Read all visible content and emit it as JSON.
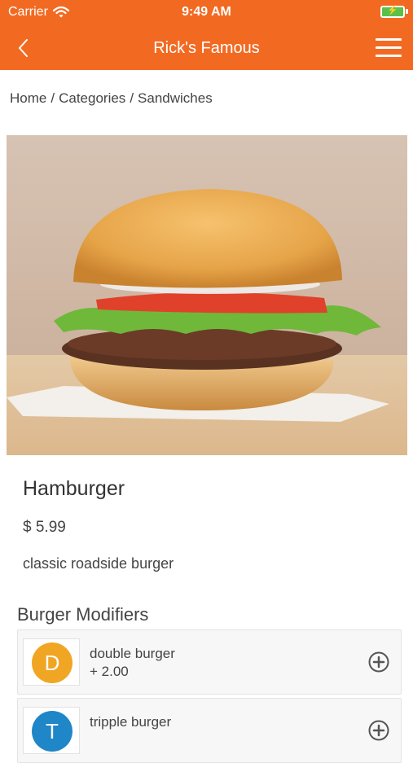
{
  "status": {
    "carrier": "Carrier",
    "time": "9:49 AM"
  },
  "nav": {
    "title": "Rick's Famous"
  },
  "breadcrumb": {
    "home": "Home",
    "categories": "Categories",
    "current": "Sandwiches",
    "separator": "/"
  },
  "product": {
    "name": "Hamburger",
    "price": "$ 5.99",
    "description": "classic roadside burger"
  },
  "modifiers": {
    "heading": "Burger Modifiers",
    "items": [
      {
        "initial": "D",
        "name": "double burger",
        "price": "+ 2.00",
        "color": "#f0a623"
      },
      {
        "initial": "T",
        "name": "tripple burger",
        "price": "",
        "color": "#1f86c7"
      }
    ]
  },
  "colors": {
    "header": "#f26a22",
    "battery": "#5ac04a"
  },
  "icons": {
    "back": "chevron-left-icon",
    "menu": "hamburger-menu-icon",
    "add": "plus-circle-icon",
    "wifi": "wifi-icon",
    "battery": "battery-charging-icon"
  }
}
